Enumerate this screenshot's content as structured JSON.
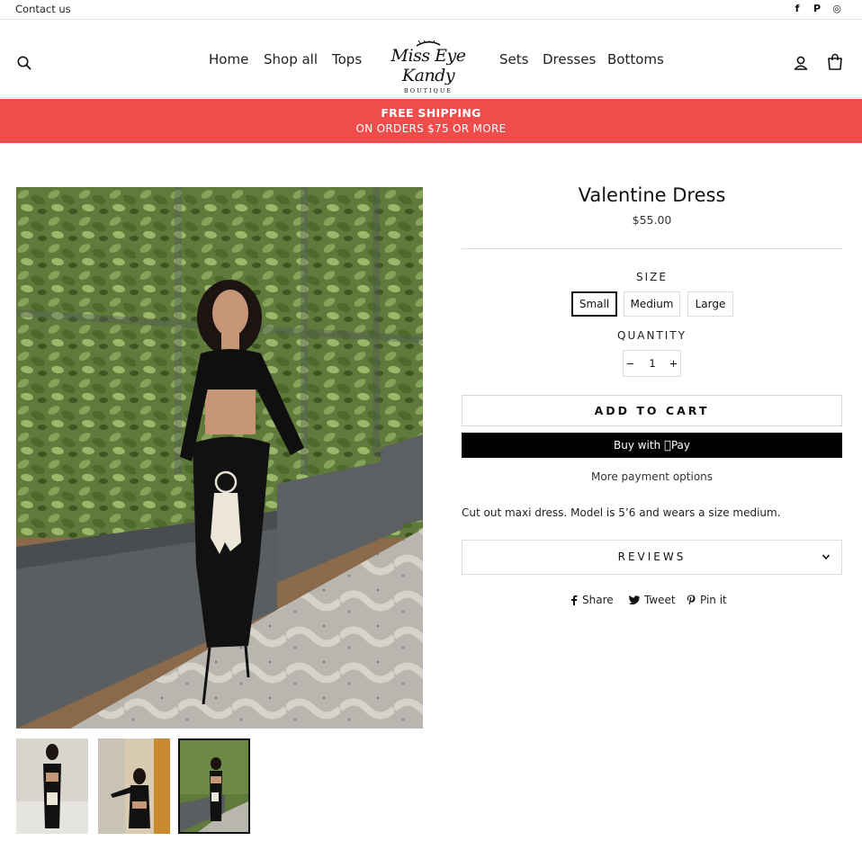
{
  "topbar": {
    "contact": "Contact us",
    "socials": [
      {
        "name": "facebook-icon",
        "glyph": "f"
      },
      {
        "name": "pinterest-icon",
        "glyph": "P"
      },
      {
        "name": "instagram-icon",
        "glyph": "◎"
      }
    ]
  },
  "header": {
    "nav": [
      "Home",
      "Shop all",
      "Tops",
      "Sets",
      "Dresses",
      "Bottoms"
    ],
    "logo": {
      "script": "Miss Eye Kandy",
      "sub": "BOUTIQUE"
    },
    "icons": [
      "search-icon",
      "account-icon",
      "cart-icon"
    ]
  },
  "promo": {
    "line1": "FREE SHIPPING",
    "line2": "ON ORDERS $75 OR MORE"
  },
  "product": {
    "title": "Valentine Dress",
    "price": "$55.00",
    "size_label": "SIZE",
    "sizes": [
      "Small",
      "Medium",
      "Large"
    ],
    "selected_size": "Small",
    "quantity_label": "QUANTITY",
    "quantity": "1",
    "qty_minus": "−",
    "qty_plus": "+",
    "add_to_cart": "ADD TO CART",
    "buy_with": "Buy with",
    "pay_brand": "Pay",
    "more_payment": "More payment options",
    "description": "Cut out maxi dress. Model is 5’6 and wears a size medium.",
    "reviews": "REVIEWS",
    "share": [
      "Share",
      "Tweet",
      "Pin it"
    ]
  },
  "colors": {
    "promo": "#ee4d4b",
    "button_dark": "#000000",
    "text": "#111111"
  }
}
